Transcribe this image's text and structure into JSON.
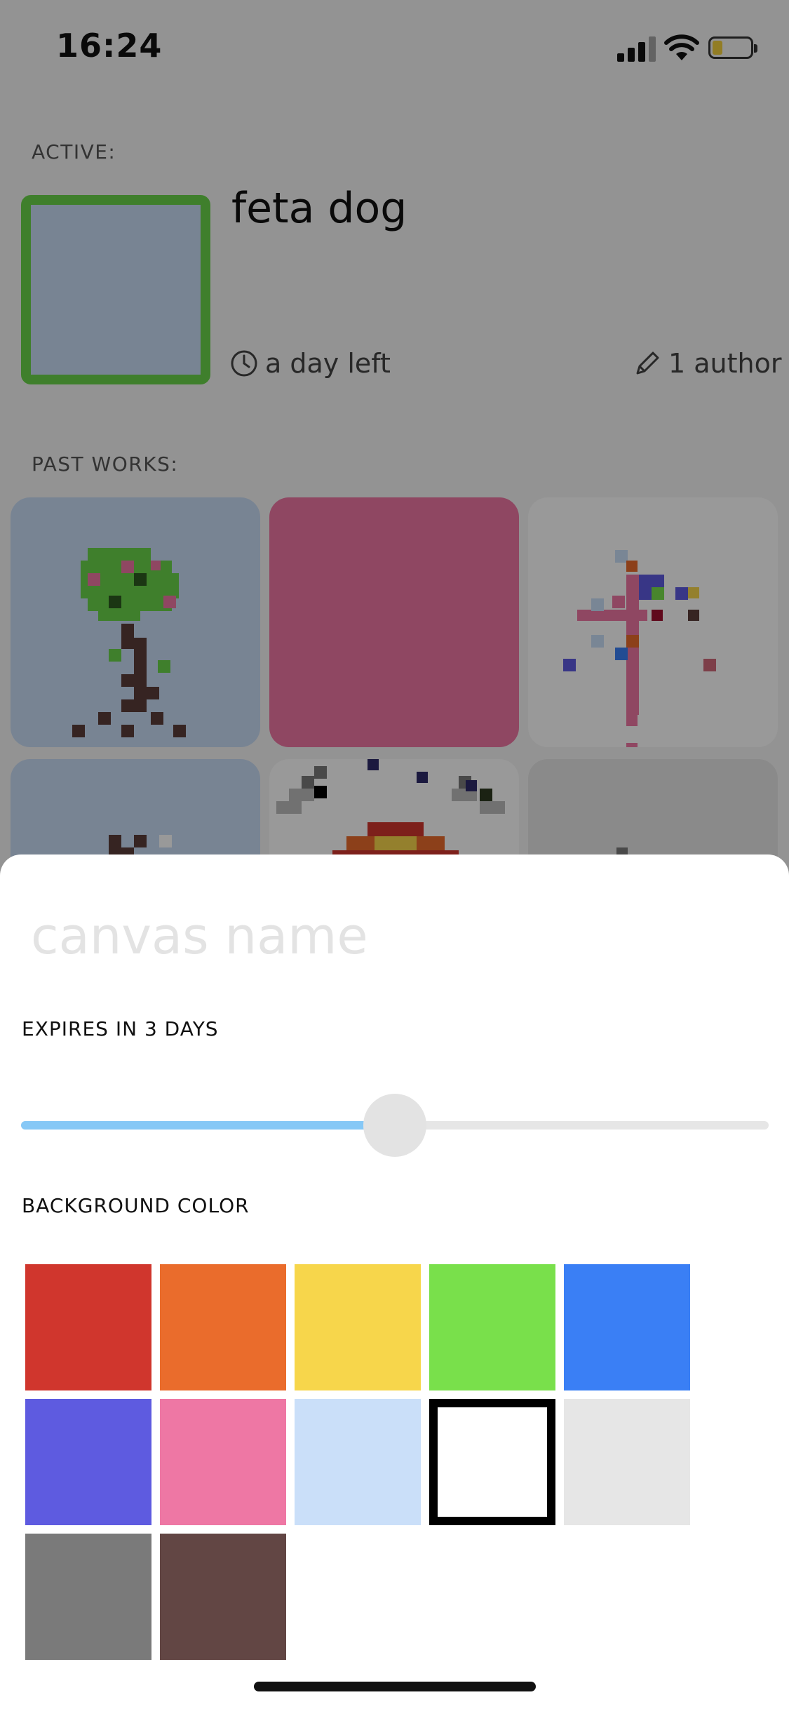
{
  "status_bar": {
    "time": "16:24"
  },
  "active": {
    "section_label": "ACTIVE:",
    "title": "feta dog",
    "time_left": "a day left",
    "authors": "1 author",
    "thumb_color": "#c9dcf5"
  },
  "past_works": {
    "section_label": "PAST WORKS:"
  },
  "sheet": {
    "name_placeholder": "canvas name",
    "expires_label": "EXPIRES IN 3 DAYS",
    "expires_slider_value": 0.5,
    "background_label": "BACKGROUND COLOR",
    "colors": [
      "#d0362d",
      "#ea6c2c",
      "#f7d64b",
      "#79e04b",
      "#3a7ff5",
      "#5e5be0",
      "#ee77a4",
      "#cadff9",
      "#ffffff",
      "#e6e6e6",
      "#7a7a7a",
      "#624644"
    ],
    "selected_index": 8
  }
}
